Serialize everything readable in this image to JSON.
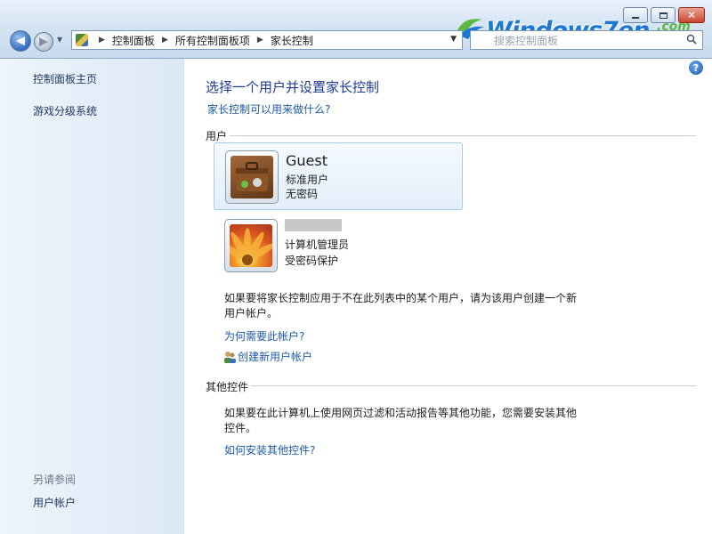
{
  "window": {
    "controls": {
      "minimize": "minimize",
      "maximize": "maximize",
      "close": "close"
    }
  },
  "nav": {
    "breadcrumb": [
      "控制面板",
      "所有控制面板项",
      "家长控制"
    ],
    "search_placeholder": "搜索控制面板"
  },
  "watermark": {
    "text": "Windows7en",
    "suffix": ".com"
  },
  "sidebar": {
    "links": [
      "控制面板主页",
      "游戏分级系统"
    ],
    "see_also_heading": "另请参阅",
    "see_also": [
      "用户帐户"
    ]
  },
  "main": {
    "title": "选择一个用户并设置家长控制",
    "what_link": "家长控制可以用来做什么?",
    "users_heading": "用户",
    "users": [
      {
        "name": "Guest",
        "type": "标准用户",
        "password": "无密码",
        "icon": "suitcase-icon",
        "selected": true
      },
      {
        "name": "",
        "type": "计算机管理员",
        "password": "受密码保护",
        "icon": "flower-icon",
        "selected": false
      }
    ],
    "create_note_line1": "如果要将家长控制应用于不在此列表中的某个用户，请为该用户创建一个新",
    "create_note_line2": "用户帐户。",
    "why_link": "为何需要此帐户?",
    "create_link": "创建新用户帐户",
    "other_heading": "其他控件",
    "other_note_line1": "如果要在此计算机上使用网页过滤和活动报告等其他功能，您需要安装其他",
    "other_note_line2": "控件。",
    "install_link": "如何安装其他控件?"
  },
  "colors": {
    "link": "#1c5aa6",
    "title": "#1e3b96",
    "sidebar_bg": "#dce8f6",
    "selection_border": "#a8cbe8"
  }
}
